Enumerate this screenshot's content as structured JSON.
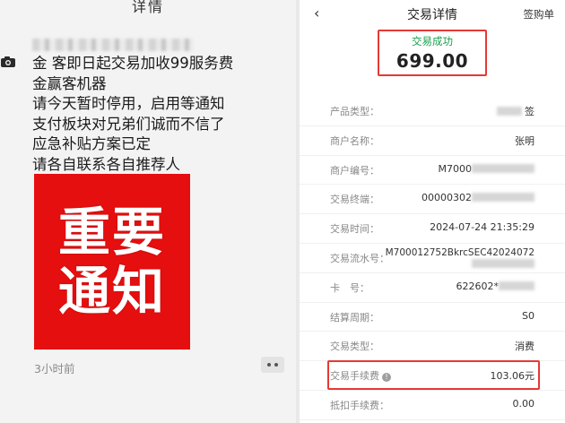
{
  "left": {
    "title": "详情",
    "post_lines": [
      "金 客即日起交易加收99服务费",
      "金赢客机器",
      "请今天暂时停用，启用等通知",
      "支付板块对兄弟们诚而不信了",
      "应急补贴方案已定",
      "请各自联系各自推荐人"
    ],
    "notice": [
      "重要",
      "通知"
    ],
    "time": "3小时前"
  },
  "right": {
    "title": "交易详情",
    "sign_label": "签购单",
    "status": "交易成功",
    "amount": "699.00",
    "rows": [
      {
        "label": "产品类型：",
        "value": "签"
      },
      {
        "label": "商户名称：",
        "value": "张明"
      },
      {
        "label": "商户编号：",
        "value": "M7000"
      },
      {
        "label": "交易终端：",
        "value": "00000302"
      },
      {
        "label": "交易时间：",
        "value": "2024-07-24 21:35:29"
      },
      {
        "label": "交易流水号：",
        "value": "M700012752BkrcSEC42024072"
      },
      {
        "label": "卡　号：",
        "value": "622602*"
      },
      {
        "label": "结算周期：",
        "value": "S0"
      },
      {
        "label": "交易类型：",
        "value": "消费"
      },
      {
        "label": "交易手续费",
        "value": "103.06元"
      },
      {
        "label": "抵扣手续费：",
        "value": "0.00"
      }
    ]
  },
  "colors": {
    "accent_red": "#e53935",
    "success_green": "#16a34a",
    "notice_red": "#e60f0f"
  }
}
